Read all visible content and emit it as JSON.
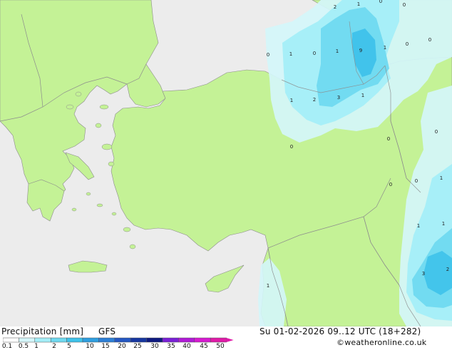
{
  "footer": {
    "title": "Precipitation [mm]",
    "model": "GFS",
    "datetime": "Su 01-02-2026 09..12 UTC (18+282)",
    "credit": "©weatheronline.co.uk"
  },
  "legend": {
    "labels": [
      "0.1",
      "0.5",
      "1",
      "2",
      "5",
      "10",
      "15",
      "20",
      "25",
      "30",
      "35",
      "40",
      "45",
      "50"
    ],
    "colors": [
      "#ffffff",
      "#d4f6fa",
      "#a4eef8",
      "#6fd9f0",
      "#3ec2ea",
      "#2f9fe0",
      "#2d7fd6",
      "#2457c2",
      "#1637a0",
      "#0e1a80",
      "#7a1fd6",
      "#b01ad6",
      "#d61ad0",
      "#e01aa8"
    ]
  },
  "colors": {
    "sea": "#ececec",
    "land": "#c4f296",
    "border": "#8d8d8d",
    "precip_light": "#d4f6fa",
    "precip_mid": "#a4eef8",
    "precip_strong": "#6fd9f0",
    "precip_heavy": "#3ec2ea"
  },
  "map_values": [
    "2",
    "1",
    "0",
    "0",
    "0",
    "1",
    "0",
    "1",
    "9",
    "1",
    "0",
    "0",
    "1",
    "2",
    "3",
    "1",
    "0",
    "0",
    "0",
    "0",
    "0",
    "1",
    "1",
    "1",
    "3",
    "2",
    "1"
  ]
}
